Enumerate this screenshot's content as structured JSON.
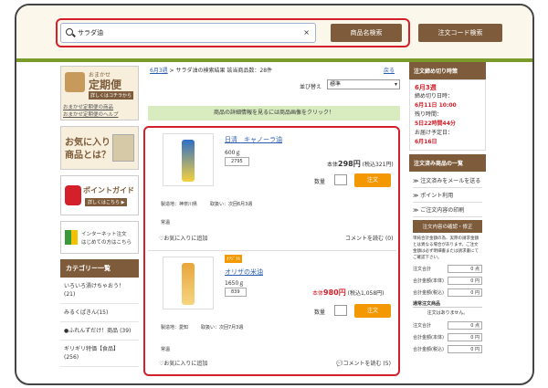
{
  "search": {
    "value": "サラダ油",
    "clear": "×",
    "btn_name": "商品名検索",
    "btn_code": "注文コード検索"
  },
  "left": {
    "teiki": {
      "line1": "おまかせ",
      "line2": "定期便",
      "tag": "詳しくはコチラから",
      "link1": "おまかせ定期便の商品",
      "link2": "おまかせ定期便のヘルプ"
    },
    "fav": {
      "line1": "お気に入り",
      "line2": "商品とは？"
    },
    "point": {
      "title": "ポイントガイド",
      "tag": "詳しくはこちら ▶"
    },
    "net": {
      "line1": "インターネット注文",
      "line2": "はじめての方はこちら"
    },
    "cat_head": "カテゴリー一覧",
    "cats": [
      "いろいろ漬けちゃおう！(21)",
      "みるくぱきん(15)",
      "●ふれんずだけ！商品 (39)",
      "ギリギリ特価【食品】 (256)"
    ]
  },
  "main": {
    "crumb_link": "6月3週",
    "crumb_rest": " > サラダ油の検索結果 該当商品数：28件",
    "back": "戻る",
    "sort_label": "並び替え",
    "sort_value": "標準",
    "hint": "商品の詳細情報を見るには商品画像をクリック！",
    "p1": {
      "name": "日清　キャノーラ油",
      "size": "600ｇ",
      "code": "2795",
      "price_label": "本体",
      "price": "298円",
      "tax": "(税込321円)",
      "qty": "数量",
      "order": "注文",
      "maker": "製造地：神奈川県",
      "handling": "取扱い：次回6月3週",
      "tag": "常温",
      "fav": "お気に入りに追加",
      "comment": "コメントを読む",
      "comment_n": "(0)"
    },
    "p2": {
      "badge": "ｵﾘｼﾞﾅﾙ",
      "name": "オリザの米油",
      "size": "1650ｇ",
      "code": "839",
      "price_label": "本体",
      "price": "980円",
      "tax": "(税込1,058円)",
      "qty": "数量",
      "order": "注文",
      "maker": "製造地：愛知",
      "handling": "取扱い：次回7月3週",
      "tag": "常温",
      "fav": "お気に入りに追加",
      "comment": "コメントを読む",
      "comment_n": "(5)"
    }
  },
  "right": {
    "deadline_head": "注文締め切り時策",
    "week": "6月3週",
    "close_label": "締め切り日時：",
    "close_value": "6月11日 10:00",
    "remain_label": "残り時間：",
    "remain_value": "5日22時間44分",
    "delivery_label": "お届け予定日：",
    "delivery_value": "6月16日",
    "ordered_head": "注文済み商品の一覧",
    "links": [
      "注文済みをメールを送る",
      "ポイント利用",
      "ご注文内容の印刷"
    ],
    "confirm": "注文内容の確認・修正",
    "note": "単純合計金額の為、実際の請求金額とは異なる場合があります。ご注文金額は必ず明細書または請求書にてご確認下さい。",
    "rows": [
      {
        "label": "注文合計",
        "value": "0 点"
      },
      {
        "label": "合計金額(本体)",
        "value": "0 円"
      },
      {
        "label": "合計金額(税込)",
        "value": "0 円"
      }
    ],
    "regular_head": "通常注文商品",
    "regular_none": "注文はありません。",
    "rows2": [
      {
        "label": "注文合計",
        "value": "0 点"
      },
      {
        "label": "合計金額(本体)",
        "value": "0 円"
      },
      {
        "label": "合計金額(税込)",
        "value": "0 円"
      }
    ]
  }
}
